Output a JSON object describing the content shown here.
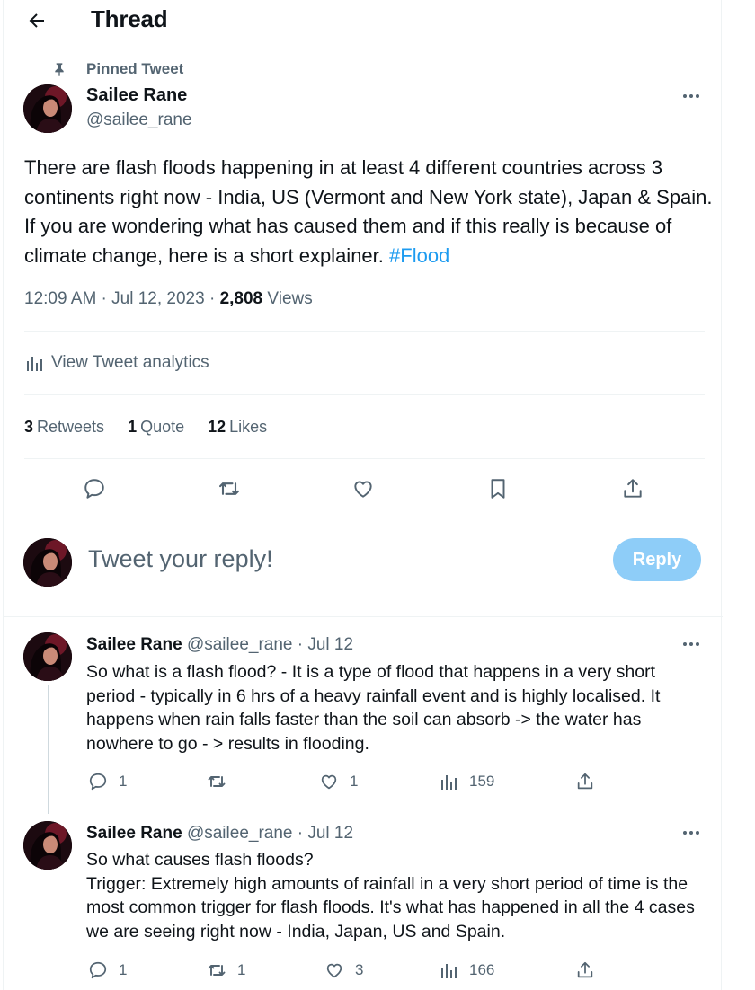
{
  "header": {
    "title": "Thread"
  },
  "pinned_label": "Pinned Tweet",
  "main_tweet": {
    "author_name": "Sailee Rane",
    "author_handle": "@sailee_rane",
    "text": "There are flash floods happening in at least 4 different countries across 3 continents right now - India, US (Vermont and New York state), Japan & Spain. If you are wondering what has caused them and if this really is because of climate change, here is a short explainer. ",
    "hashtag": "#Flood",
    "timestamp": "12:09 AM · Jul 12, 2023 · ",
    "views_count": "2,808",
    "views_label": " Views",
    "analytics_label": "View Tweet analytics",
    "retweets_count": "3",
    "retweets_label": "Retweets",
    "quotes_count": "1",
    "quotes_label": "Quote",
    "likes_count": "12",
    "likes_label": "Likes"
  },
  "composer": {
    "placeholder": "Tweet your reply!",
    "reply_button": "Reply"
  },
  "replies": [
    {
      "author_name": "Sailee Rane",
      "meta": "@sailee_rane · Jul 12",
      "text": "So what is a flash flood? - It is a type of flood that happens in a very short period - typically in 6 hrs of a heavy rainfall event and is highly localised. It happens when rain falls faster than the soil can absorb -> the water has nowhere to go - > results in flooding.",
      "replies": "1",
      "retweets": "",
      "likes": "1",
      "views": "159"
    },
    {
      "author_name": "Sailee Rane",
      "meta": "@sailee_rane · Jul 12",
      "text_line1": "So what causes flash floods?",
      "text_line2": "Trigger: Extremely high amounts of rainfall in a very short period of time is the most common trigger for flash floods. It's what has happened in all the 4 cases we are seeing right now - India, Japan, US and Spain.",
      "replies": "1",
      "retweets": "1",
      "likes": "3",
      "views": "166"
    }
  ],
  "colors": {
    "text": "#0f1419",
    "secondary": "#536471",
    "link": "#1d9bf0",
    "reply_button_disabled": "#8ecdf8",
    "divider": "#eff3f4"
  },
  "icons": [
    "back-arrow-icon",
    "pin-icon",
    "more-icon",
    "analytics-icon",
    "reply-icon",
    "retweet-icon",
    "like-icon",
    "bookmark-icon",
    "share-icon",
    "views-icon"
  ]
}
